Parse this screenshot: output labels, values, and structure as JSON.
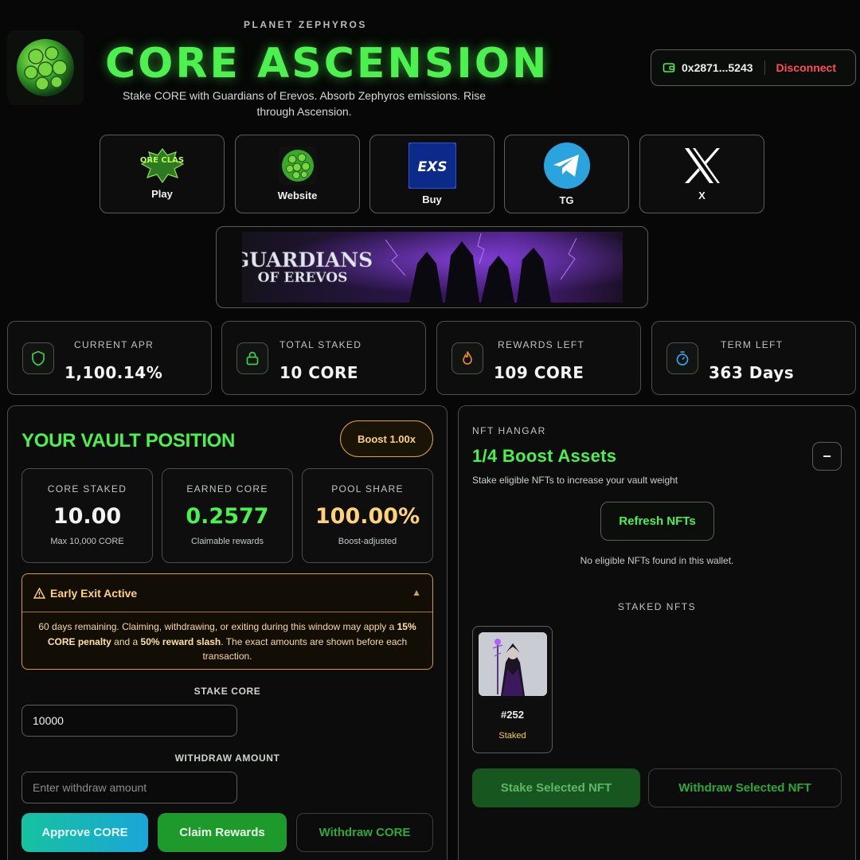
{
  "header": {
    "planet_label": "PLANET ZEPHYROS",
    "title": "CORE ASCENSION",
    "subtitle": "Stake CORE with Guardians of Erevos. Absorb Zephyros emissions. Rise through Ascension.",
    "logo_icon": "planet-orb-icon"
  },
  "wallet": {
    "address": "0x2871...5243",
    "disconnect_label": "Disconnect",
    "icon": "wallet-icon"
  },
  "links": [
    {
      "label": "Play",
      "icon": "core-clash-logo-icon",
      "logo_text": "CORE CLASH"
    },
    {
      "label": "Website",
      "icon": "planet-orb-icon"
    },
    {
      "label": "Buy",
      "icon": "exchange-logo-icon",
      "logo_text": "EXS"
    },
    {
      "label": "TG",
      "icon": "telegram-icon"
    },
    {
      "label": "X",
      "icon": "x-logo-icon"
    }
  ],
  "banner": {
    "line1": "GUARDIANS",
    "line2": "OF EREVOS"
  },
  "stats": [
    {
      "label": "CURRENT APR",
      "value": "1,100.14%",
      "icon": "shield-icon",
      "color": "#3ecf4a"
    },
    {
      "label": "TOTAL STAKED",
      "value": "10 CORE",
      "icon": "lock-icon",
      "color": "#3ecf4a"
    },
    {
      "label": "REWARDS LEFT",
      "value": "109 CORE",
      "icon": "flame-icon",
      "color": "#f28a2e"
    },
    {
      "label": "TERM LEFT",
      "value": "363 Days",
      "icon": "timer-icon",
      "color": "#3ea0e8"
    }
  ],
  "vault": {
    "title": "YOUR VAULT POSITION",
    "boost_label": "Boost 1.00x",
    "cards": [
      {
        "label": "CORE STAKED",
        "value": "10.00",
        "sub": "Max 10,000 CORE",
        "color": "#f2f2f2"
      },
      {
        "label": "EARNED CORE",
        "value": "0.2577",
        "sub": "Claimable rewards",
        "color": "#4cf04f"
      },
      {
        "label": "POOL SHARE",
        "value": "100.00%",
        "sub": "Boost-adjusted",
        "color": "#ffd27a"
      }
    ],
    "warning": {
      "title": "Early Exit Active",
      "text_a": "60 days remaining. Claiming, withdrawing, or exiting during this window may apply a ",
      "bold_a": "15% CORE penalty",
      "text_b": " and a ",
      "bold_b": "50% reward slash",
      "text_c": ". The exact amounts are shown before each transaction."
    },
    "stake_label": "STAKE CORE",
    "stake_value": "10000",
    "withdraw_label": "WITHDRAW AMOUNT",
    "withdraw_placeholder": "Enter withdraw amount",
    "buttons": {
      "approve": "Approve CORE",
      "claim": "Claim Rewards",
      "withdraw": "Withdraw CORE"
    }
  },
  "nft": {
    "kicker": "NFT HANGAR",
    "title": "1/4 Boost Assets",
    "description": "Stake eligible NFTs to increase your vault weight",
    "collapse_symbol": "−",
    "refresh_label": "Refresh NFTs",
    "empty_text": "No eligible NFTs found in this wallet.",
    "staked_label": "STAKED NFTS",
    "staked_items": [
      {
        "id": "#252",
        "status": "Staked"
      }
    ],
    "stake_selected": "Stake Selected NFT",
    "withdraw_selected": "Withdraw Selected NFT"
  }
}
